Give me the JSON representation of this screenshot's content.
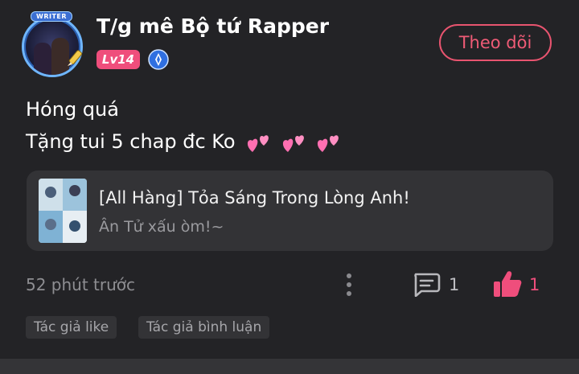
{
  "user": {
    "name": "T/g mê Bộ tứ Rapper",
    "level": "Lv14",
    "avatar_badge": "WRITER"
  },
  "follow_button": {
    "label": "Theo dõi"
  },
  "post": {
    "lines": [
      "Hóng quá",
      "Tặng tui 5 chap đc Ko"
    ],
    "emoji": [
      "two-hearts",
      "two-hearts",
      "two-hearts"
    ]
  },
  "comic": {
    "title": "[All Hàng] Tỏa Sáng Trong Lòng Anh!",
    "subtitle": "Ân Tử xấu òm!~"
  },
  "meta": {
    "timestamp": "52 phút trước",
    "comment_count": "1",
    "like_count": "1"
  },
  "tags": [
    "Tác giả like",
    "Tác giả bình luận"
  ],
  "colors": {
    "background": "#232326",
    "card": "#333336",
    "accent": "#ef4e7c",
    "follow_border": "#e8546f",
    "muted_text": "#8e8e92"
  },
  "icons": [
    "writer-avatar-frame",
    "pen-icon",
    "verified-icon",
    "more-icon",
    "comment-icon",
    "like-icon",
    "two-hearts-icon"
  ]
}
